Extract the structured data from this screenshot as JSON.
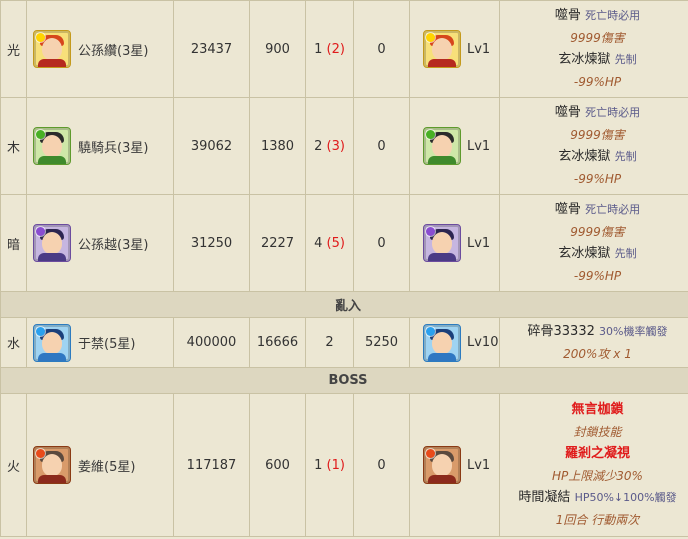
{
  "rows": [
    {
      "attr": "光",
      "name": "公孫纘(3星)",
      "hp": "23437",
      "atk": "900",
      "cd": "1",
      "cd_max": "(2)",
      "def": "0",
      "lv": "Lv1",
      "skills": [
        {
          "name": "噬骨",
          "desc": "死亡時必用"
        },
        {
          "effect": "9999傷害"
        },
        {
          "name": "玄冰煉獄",
          "desc": "先制"
        },
        {
          "effect": "-99%HP"
        }
      ]
    },
    {
      "attr": "木",
      "name": "驍騎兵(3星)",
      "hp": "39062",
      "atk": "1380",
      "cd": "2",
      "cd_max": "(3)",
      "def": "0",
      "lv": "Lv1",
      "skills": [
        {
          "name": "噬骨",
          "desc": "死亡時必用"
        },
        {
          "effect": "9999傷害"
        },
        {
          "name": "玄冰煉獄",
          "desc": "先制"
        },
        {
          "effect": "-99%HP"
        }
      ]
    },
    {
      "attr": "暗",
      "name": "公孫越(3星)",
      "hp": "31250",
      "atk": "2227",
      "cd": "4",
      "cd_max": "(5)",
      "def": "0",
      "lv": "Lv1",
      "skills": [
        {
          "name": "噬骨",
          "desc": "死亡時必用"
        },
        {
          "effect": "9999傷害"
        },
        {
          "name": "玄冰煉獄",
          "desc": "先制"
        },
        {
          "effect": "-99%HP"
        }
      ]
    }
  ],
  "section_intrude": "亂入",
  "intruder": {
    "attr": "水",
    "name": "于禁(5星)",
    "hp": "400000",
    "atk": "16666",
    "cd": "2",
    "def": "5250",
    "lv": "Lv10",
    "skill_name": "碎骨33332",
    "skill_desc": "30%機率觸發",
    "skill_effect": "200%攻 x 1"
  },
  "section_boss": "BOSS",
  "boss": {
    "attr": "火",
    "name": "姜維(5星)",
    "hp": "117187",
    "atk": "600",
    "cd": "1",
    "cd_max": "(1)",
    "def": "0",
    "lv": "Lv1",
    "skill1_name": "無言枷鎖",
    "skill1_effect": "封鎖技能",
    "skill2_name": "羅剎之凝視",
    "skill2_effect": "HP上限減少30%",
    "skill3_name": "時間凝結",
    "skill3_desc": "HP50%↓100%觸發",
    "skill3_effect": "1回合 行動兩次"
  },
  "icons": {
    "light": "light-attribute-monster-icon",
    "wood": "wood-attribute-monster-icon",
    "dark": "dark-attribute-monster-icon",
    "water": "water-attribute-monster-icon",
    "fire": "fire-attribute-monster-icon"
  }
}
